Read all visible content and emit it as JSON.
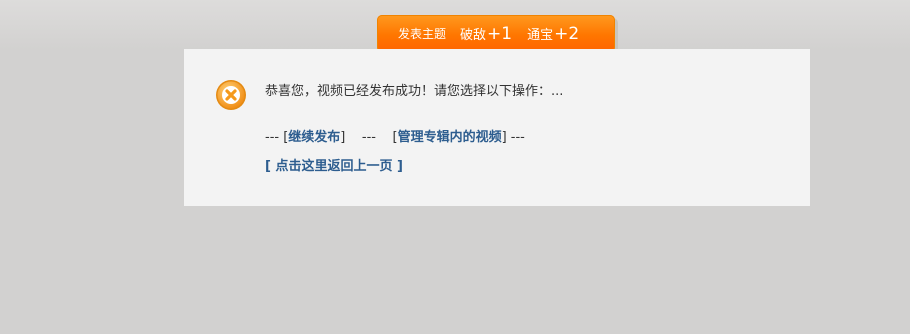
{
  "reward": {
    "title": "发表主题",
    "items": [
      {
        "label": "破敌",
        "value": "+1"
      },
      {
        "label": "通宝",
        "value": "+2"
      }
    ]
  },
  "message": {
    "icon": "error-x-icon",
    "icon_color": "#f7a51f",
    "text": "恭喜您，视频已经发布成功！请您选择以下操作：..."
  },
  "actions": {
    "prefix": "--- [",
    "continue_label": "继续发布",
    "mid": "]    ---    [",
    "manage_label": "管理专辑内的视频",
    "suffix": "] ---",
    "back_label": "[ 点击这里返回上一页 ]",
    "link_color": "#2d5d8f"
  }
}
